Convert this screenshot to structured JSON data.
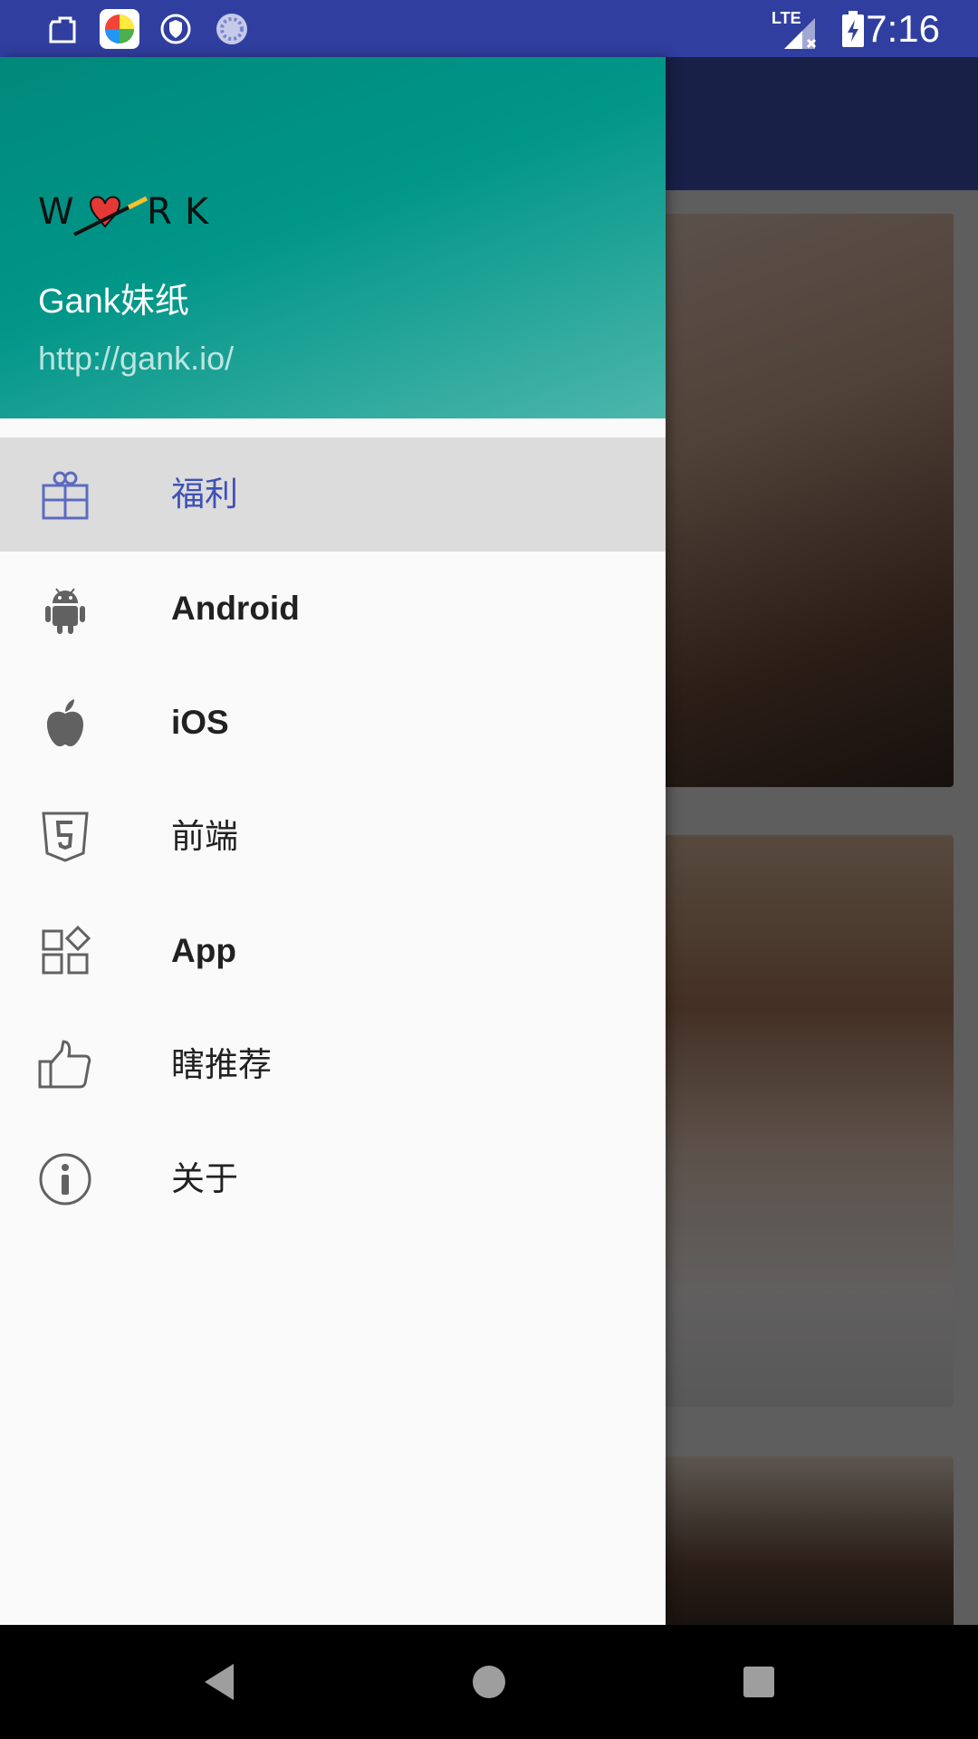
{
  "status_bar": {
    "time": "7:16",
    "icons": [
      "clipboard-icon",
      "colorful-app-icon",
      "shield-icon",
      "loading-icon",
      "lte-signal-icon",
      "battery-charging-icon"
    ],
    "network_label": "LTE",
    "color": "#303f9f"
  },
  "drawer": {
    "header": {
      "logo_text": "W♥RK",
      "title": "Gank妹纸",
      "url": "http://gank.io/"
    },
    "menu": [
      {
        "label": "福利",
        "icon": "gift-icon",
        "selected": true
      },
      {
        "label": "Android",
        "icon": "android-icon",
        "selected": false
      },
      {
        "label": "iOS",
        "icon": "apple-icon",
        "selected": false
      },
      {
        "label": "前端",
        "icon": "html5-icon",
        "selected": false
      },
      {
        "label": "App",
        "icon": "apps-grid-icon",
        "selected": false
      },
      {
        "label": "瞎推荐",
        "icon": "thumbs-up-icon",
        "selected": false
      },
      {
        "label": "关于",
        "icon": "info-icon",
        "selected": false
      }
    ],
    "accent_color": "#3f51b5",
    "header_color": "#009688"
  },
  "navigation_bar": {
    "buttons": [
      "back-icon",
      "home-icon",
      "recents-icon"
    ]
  }
}
